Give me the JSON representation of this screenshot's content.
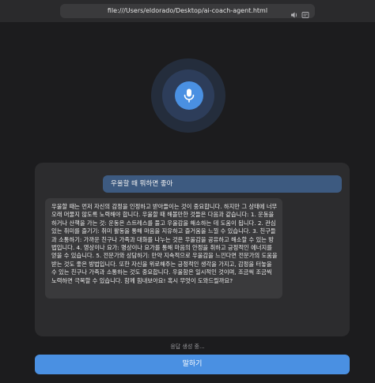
{
  "browser": {
    "url": "file:///Users/eldorado/Desktop/ai-coach-agent.html"
  },
  "icons": {
    "mic": "microphone-icon",
    "audio": "speaker-icon",
    "reader": "reader-icon",
    "site_info": "site-info-icon"
  },
  "colors": {
    "accent": "#4a90e2",
    "user_bubble": "#3d5a80",
    "ai_bubble": "#3a3a3c",
    "panel": "#2c2c2e",
    "background": "#1c1c1e"
  },
  "chat": {
    "messages": [
      {
        "role": "user",
        "text": "우울할 때 뭐하면 좋아"
      },
      {
        "role": "assistant",
        "text": "우울할 때는 먼저 자신의 감정을 인정하고 받아들이는 것이 중요합니다. 하지만 그 상태에 너무 오래 머물지 않도록 노력해야 합니다. 우울할 때 해볼만한 것들은 다음과 같습니다: 1. 운동을 하거나 산책을 가는 것: 운동은 스트레스를 풀고 우울감을 해소하는 데 도움이 됩니다. 2. 관심 있는 취미를 즐기기: 취미 활동을 통해 마음을 지유하고 즐거움을 느낄 수 있습니다. 3. 친구들과 소통하기: 가까운 친구나 가족과 대화를 나누는 것은 우울감을 공유하고 해소할 수 있는 방법입니다. 4. 영상이나 요가: 명상이나 요가를 통해 마음의 안정을 취하고 긍정적인 에너지를 얻을 수 있습니다. 5. 전문가와 상담하기: 만약 지속적으로 우울감을 느낀다면 전문가의 도움을 받는 것도 좋은 방법입니다. 또한 자신을 위로해주는 긍정적인 생각을 가지고, 감정을 터놓을 수 있는 친구나 가족과 소통하는 것도 중요합니다. 우울함은 일시적인 것이며, 조금씩 조금씩 노력하면 극복할 수 있습니다. 함께 힘내보아요! 혹시 무엇이 도와드릴까요?"
      }
    ]
  },
  "status": {
    "text": "응답 생성 중..."
  },
  "controls": {
    "speak_label": "말하기"
  }
}
